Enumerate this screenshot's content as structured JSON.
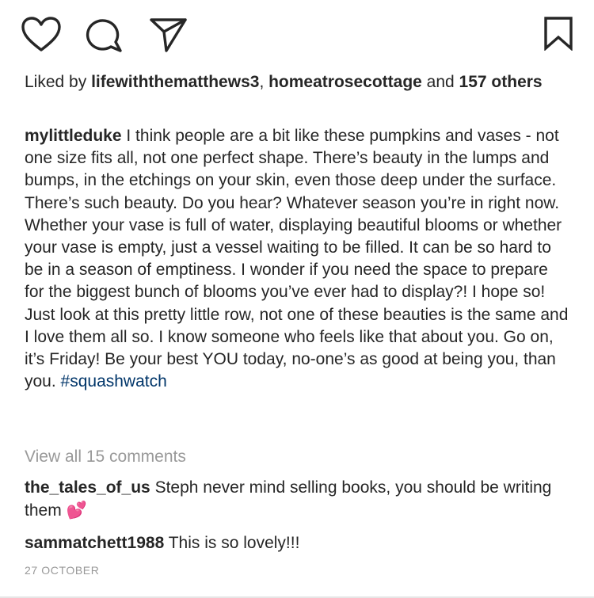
{
  "actions": {
    "icons": [
      "heart-icon",
      "comment-icon",
      "share-icon",
      "bookmark-icon"
    ]
  },
  "likes": {
    "prefix": "Liked by ",
    "user1": "lifewiththematthews3",
    "separator": ", ",
    "user2": "homeatrosecottage",
    "and": " and ",
    "others": "157 others"
  },
  "caption": {
    "username": "mylittleduke",
    "text": " I think people are a bit like these pumpkins and vases - not one size fits all, not one perfect shape. There’s beauty in the lumps and bumps, in the etchings on your skin, even those deep under the surface. There’s such beauty. Do you hear? Whatever season you’re in right now. Whether your vase is full of water, displaying beautiful blooms or whether your vase is empty, just a vessel waiting to be filled. It can be so hard to be in a season of emptiness. I wonder if you need the space to prepare for the biggest bunch of blooms you’ve ever had to display?! I hope so! Just look at this pretty little row, not one of these beauties is the same and I love them all so. I know someone who feels like that about you. Go on, it’s Friday! Be your best YOU today, no-one’s as good at being you, than you. ",
    "hashtag": "#squashwatch"
  },
  "view_all": "View all 15 comments",
  "comments": [
    {
      "username": "the_tales_of_us",
      "text": " Steph never mind selling books, you should be writing them ",
      "emoji": "💕"
    },
    {
      "username": "sammatchett1988",
      "text": " This is so lovely!!!"
    }
  ],
  "date": "27 OCTOBER",
  "colors": {
    "text": "#262626",
    "muted": "#999999",
    "hashtag": "#003569"
  }
}
